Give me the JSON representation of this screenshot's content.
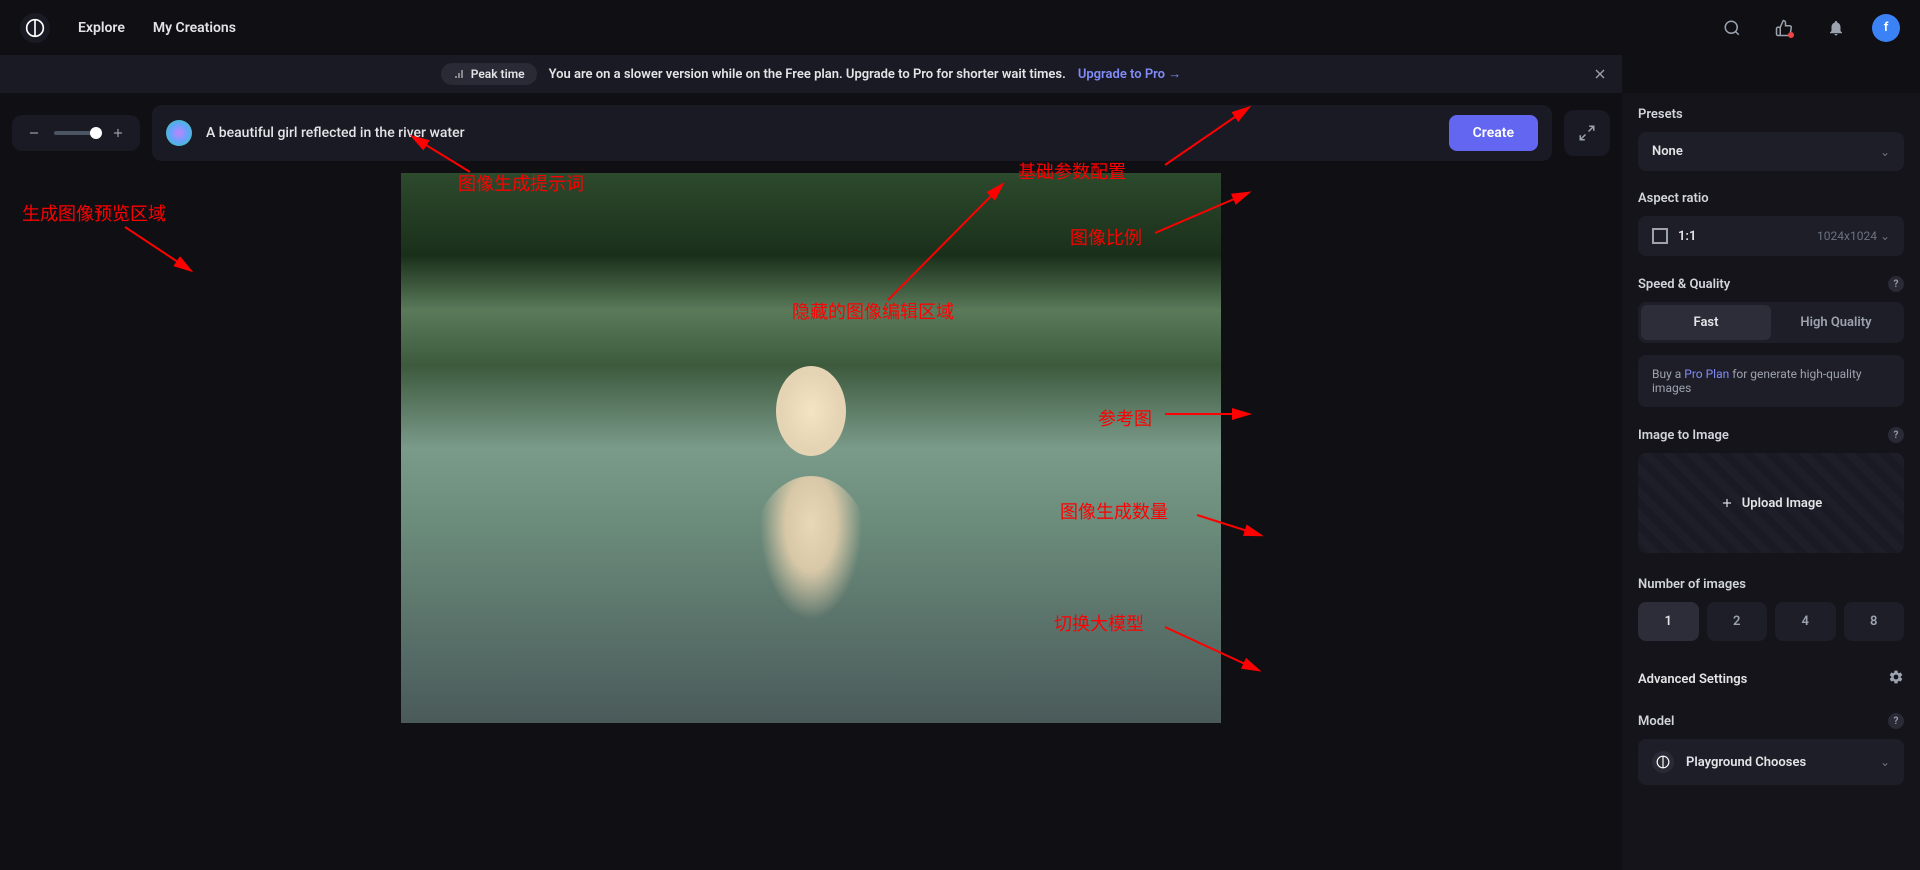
{
  "nav": {
    "explore": "Explore",
    "my_creations": "My Creations",
    "avatar_letter": "f"
  },
  "banner": {
    "peak_label": "Peak time",
    "text": "You are on a slower version while on the Free plan. Upgrade to Pro for shorter wait times.",
    "link": "Upgrade to Pro →"
  },
  "prompt": {
    "text": "A beautiful girl reflected in the river water",
    "create_label": "Create"
  },
  "sidebar": {
    "presets_label": "Presets",
    "presets_value": "None",
    "aspect_label": "Aspect ratio",
    "aspect_value": "1:1",
    "aspect_dims": "1024x1024",
    "speed_label": "Speed & Quality",
    "speed_fast": "Fast",
    "speed_hq": "High Quality",
    "pro_prefix": "Buy a ",
    "pro_link": "Pro Plan",
    "pro_suffix": " for generate high-quality images",
    "i2i_label": "Image to Image",
    "upload_label": "Upload Image",
    "num_label": "Number of images",
    "num_options": [
      "1",
      "2",
      "4",
      "8"
    ],
    "adv_label": "Advanced Settings",
    "model_label": "Model",
    "model_value": "Playground Chooses"
  },
  "annotations": {
    "preview_area": "生成图像预览区域",
    "prompt_label": "图像生成提示词",
    "hidden_edit": "隐藏的图像编辑区域",
    "basic_config": "基础参数配置",
    "aspect_ratio": "图像比例",
    "ref_image": "参考图",
    "gen_count": "图像生成数量",
    "switch_model": "切换大模型"
  }
}
